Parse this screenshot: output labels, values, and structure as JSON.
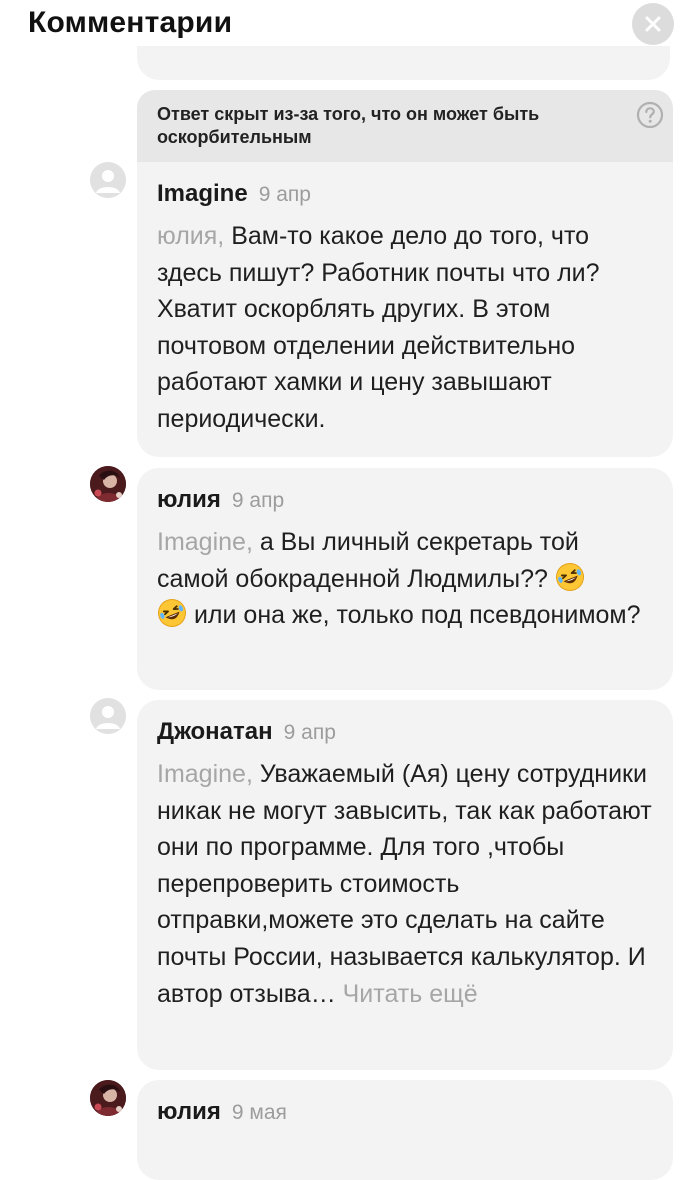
{
  "header": {
    "title": "Комментарии"
  },
  "hidden_notice": {
    "text": "Ответ скрыт из-за того, что он может быть оскорбительным"
  },
  "comments": [
    {
      "author": "Imagine",
      "date": "9 апр",
      "mention": "юлия,",
      "text": " Вам-то какое дело до того, что здесь пишут? Работник почты что ли? Хватит оскорблять других. В этом почтовом отделении действительно работают хамки и цену завышают периодически."
    },
    {
      "author": "юлия",
      "date": "9 апр",
      "mention": "Imagine,",
      "text_a": " а Вы личный секретарь той самой обокраденной Людмилы?? ",
      "text_b": " или она же, только под псевдонимом?",
      "emoji": "rolling-on-the-floor-laughing"
    },
    {
      "author": "Джонатан",
      "date": "9 апр",
      "mention": "Imagine,",
      "text": " Уважаемый (Ая) цену сотрудники никак не могут завысить, так как работают они по программе. Для того ,чтобы перепроверить стоимость отправки,можете это сделать на сайте почты России, называется калькулятор. И автор отзыва…",
      "read_more": " Читать ещё"
    },
    {
      "author": "юлия",
      "date": "9 мая"
    }
  ],
  "colors": {
    "card": "#f3f3f3",
    "banner": "#e7e7e7",
    "muted": "#a6a6a6"
  }
}
